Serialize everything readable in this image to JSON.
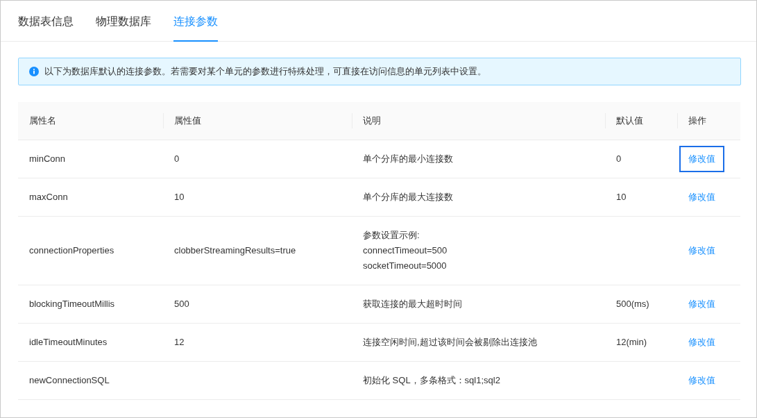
{
  "tabs": [
    {
      "label": "数据表信息",
      "selected": false
    },
    {
      "label": "物理数据库",
      "selected": false
    },
    {
      "label": "连接参数",
      "selected": true
    }
  ],
  "alert": {
    "kind": "info",
    "text": "以下为数据库默认的连接参数。若需要对某个单元的参数进行特殊处理，可直接在访问信息的单元列表中设置。"
  },
  "table": {
    "columns": [
      "属性名",
      "属性值",
      "说明",
      "默认值",
      "操作"
    ],
    "rows": [
      {
        "name": "minConn",
        "value": "0",
        "description": "单个分库的最小连接数",
        "default": "0",
        "action": {
          "label": "修改值",
          "focused": true
        }
      },
      {
        "name": "maxConn",
        "value": "10",
        "description": "单个分库的最大连接数",
        "default": "10",
        "action": {
          "label": "修改值",
          "focused": false
        }
      },
      {
        "name": "connectionProperties",
        "value": "clobberStreamingResults=true",
        "description": "参数设置示例:\nconnectTimeout=500\nsocketTimeout=5000",
        "action": {
          "label": "修改值",
          "focused": false
        }
      },
      {
        "name": "blockingTimeoutMillis",
        "value": "500",
        "description": "获取连接的最大超时时间",
        "default": "500(ms)",
        "action": {
          "label": "修改值",
          "focused": false
        }
      },
      {
        "name": "idleTimeoutMinutes",
        "value": "12",
        "description": "连接空闲时间,超过该时间会被剔除出连接池",
        "default": "12(min)",
        "action": {
          "label": "修改值",
          "focused": false
        }
      },
      {
        "name": "newConnectionSQL",
        "description": "初始化 SQL，多条格式：sql1;sql2",
        "action": {
          "label": "修改值",
          "focused": false
        }
      }
    ]
  }
}
